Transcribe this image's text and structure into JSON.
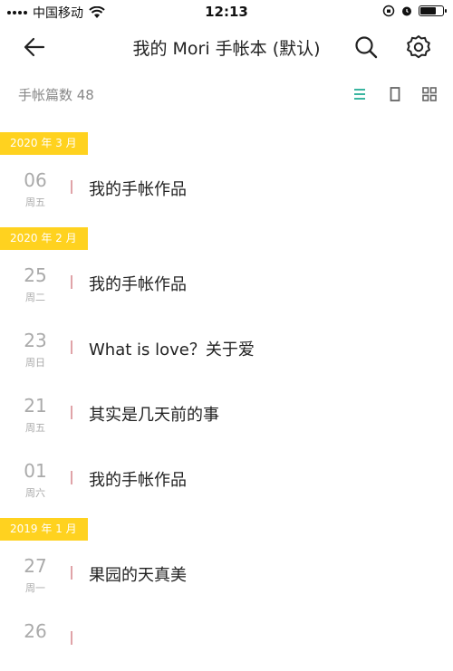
{
  "status_bar": {
    "carrier": "中国移动",
    "time": "12:13",
    "battery_level": 0.75,
    "icons": [
      "signal-icon",
      "wifi-icon",
      "orientation-lock-icon",
      "alarm-icon",
      "battery-icon"
    ]
  },
  "header": {
    "title": "我的 Mori 手帐本 (默认)",
    "icons": [
      "back-arrow-icon",
      "search-icon",
      "gear-icon"
    ]
  },
  "toolbar": {
    "count_label": "手帐篇数 48",
    "view_icons": [
      "list-view-icon",
      "single-view-icon",
      "grid-view-icon"
    ],
    "active_view": "list",
    "active_color": "#3ab5a0"
  },
  "colors": {
    "month_tag": "#ffd21f",
    "divider": "#e0a3a8",
    "date_text": "#aaaaaa"
  },
  "groups": [
    {
      "month": "2020 年 3 月",
      "entries": [
        {
          "day": "06",
          "weekday": "周五",
          "title": "我的手帐作品"
        }
      ]
    },
    {
      "month": "2020 年 2 月",
      "entries": [
        {
          "day": "25",
          "weekday": "周二",
          "title": "我的手帐作品"
        },
        {
          "day": "23",
          "weekday": "周日",
          "title": "What is love？关于爱"
        },
        {
          "day": "21",
          "weekday": "周五",
          "title": "其实是几天前的事"
        },
        {
          "day": "01",
          "weekday": "周六",
          "title": "我的手帐作品"
        }
      ]
    },
    {
      "month": "2019 年 1 月",
      "entries": [
        {
          "day": "27",
          "weekday": "周一",
          "title": "果园的天真美"
        },
        {
          "day": "26",
          "weekday": "",
          "title": ""
        }
      ]
    }
  ]
}
